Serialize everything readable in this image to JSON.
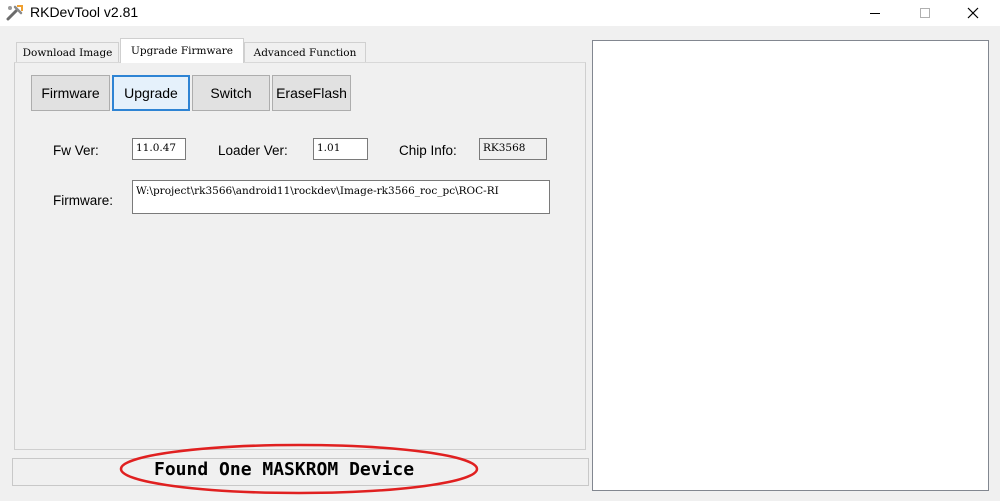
{
  "window": {
    "title": "RKDevTool v2.81"
  },
  "tabs": [
    {
      "label": "Download Image"
    },
    {
      "label": "Upgrade Firmware"
    },
    {
      "label": "Advanced Function"
    }
  ],
  "buttons": {
    "firmware": "Firmware",
    "upgrade": "Upgrade",
    "switch": "Switch",
    "erase_flash": "EraseFlash"
  },
  "info": {
    "fw_ver_label": "Fw Ver:",
    "fw_ver_value": "11.0.47",
    "loader_ver_label": "Loader Ver:",
    "loader_ver_value": "1.01",
    "chip_info_label": "Chip Info:",
    "chip_info_value": "RK3568",
    "firmware_label": "Firmware:",
    "firmware_path": "W:\\project\\rk3566\\android11\\rockdev\\Image-rk3566_roc_pc\\ROC-RI"
  },
  "status": {
    "text": "Found One MASKROM Device",
    "highlight_color": "#e02020"
  },
  "icons": {
    "app": "rk-tool-icon",
    "minimize": "minimize-icon",
    "maximize": "maximize-icon",
    "close": "close-icon"
  }
}
